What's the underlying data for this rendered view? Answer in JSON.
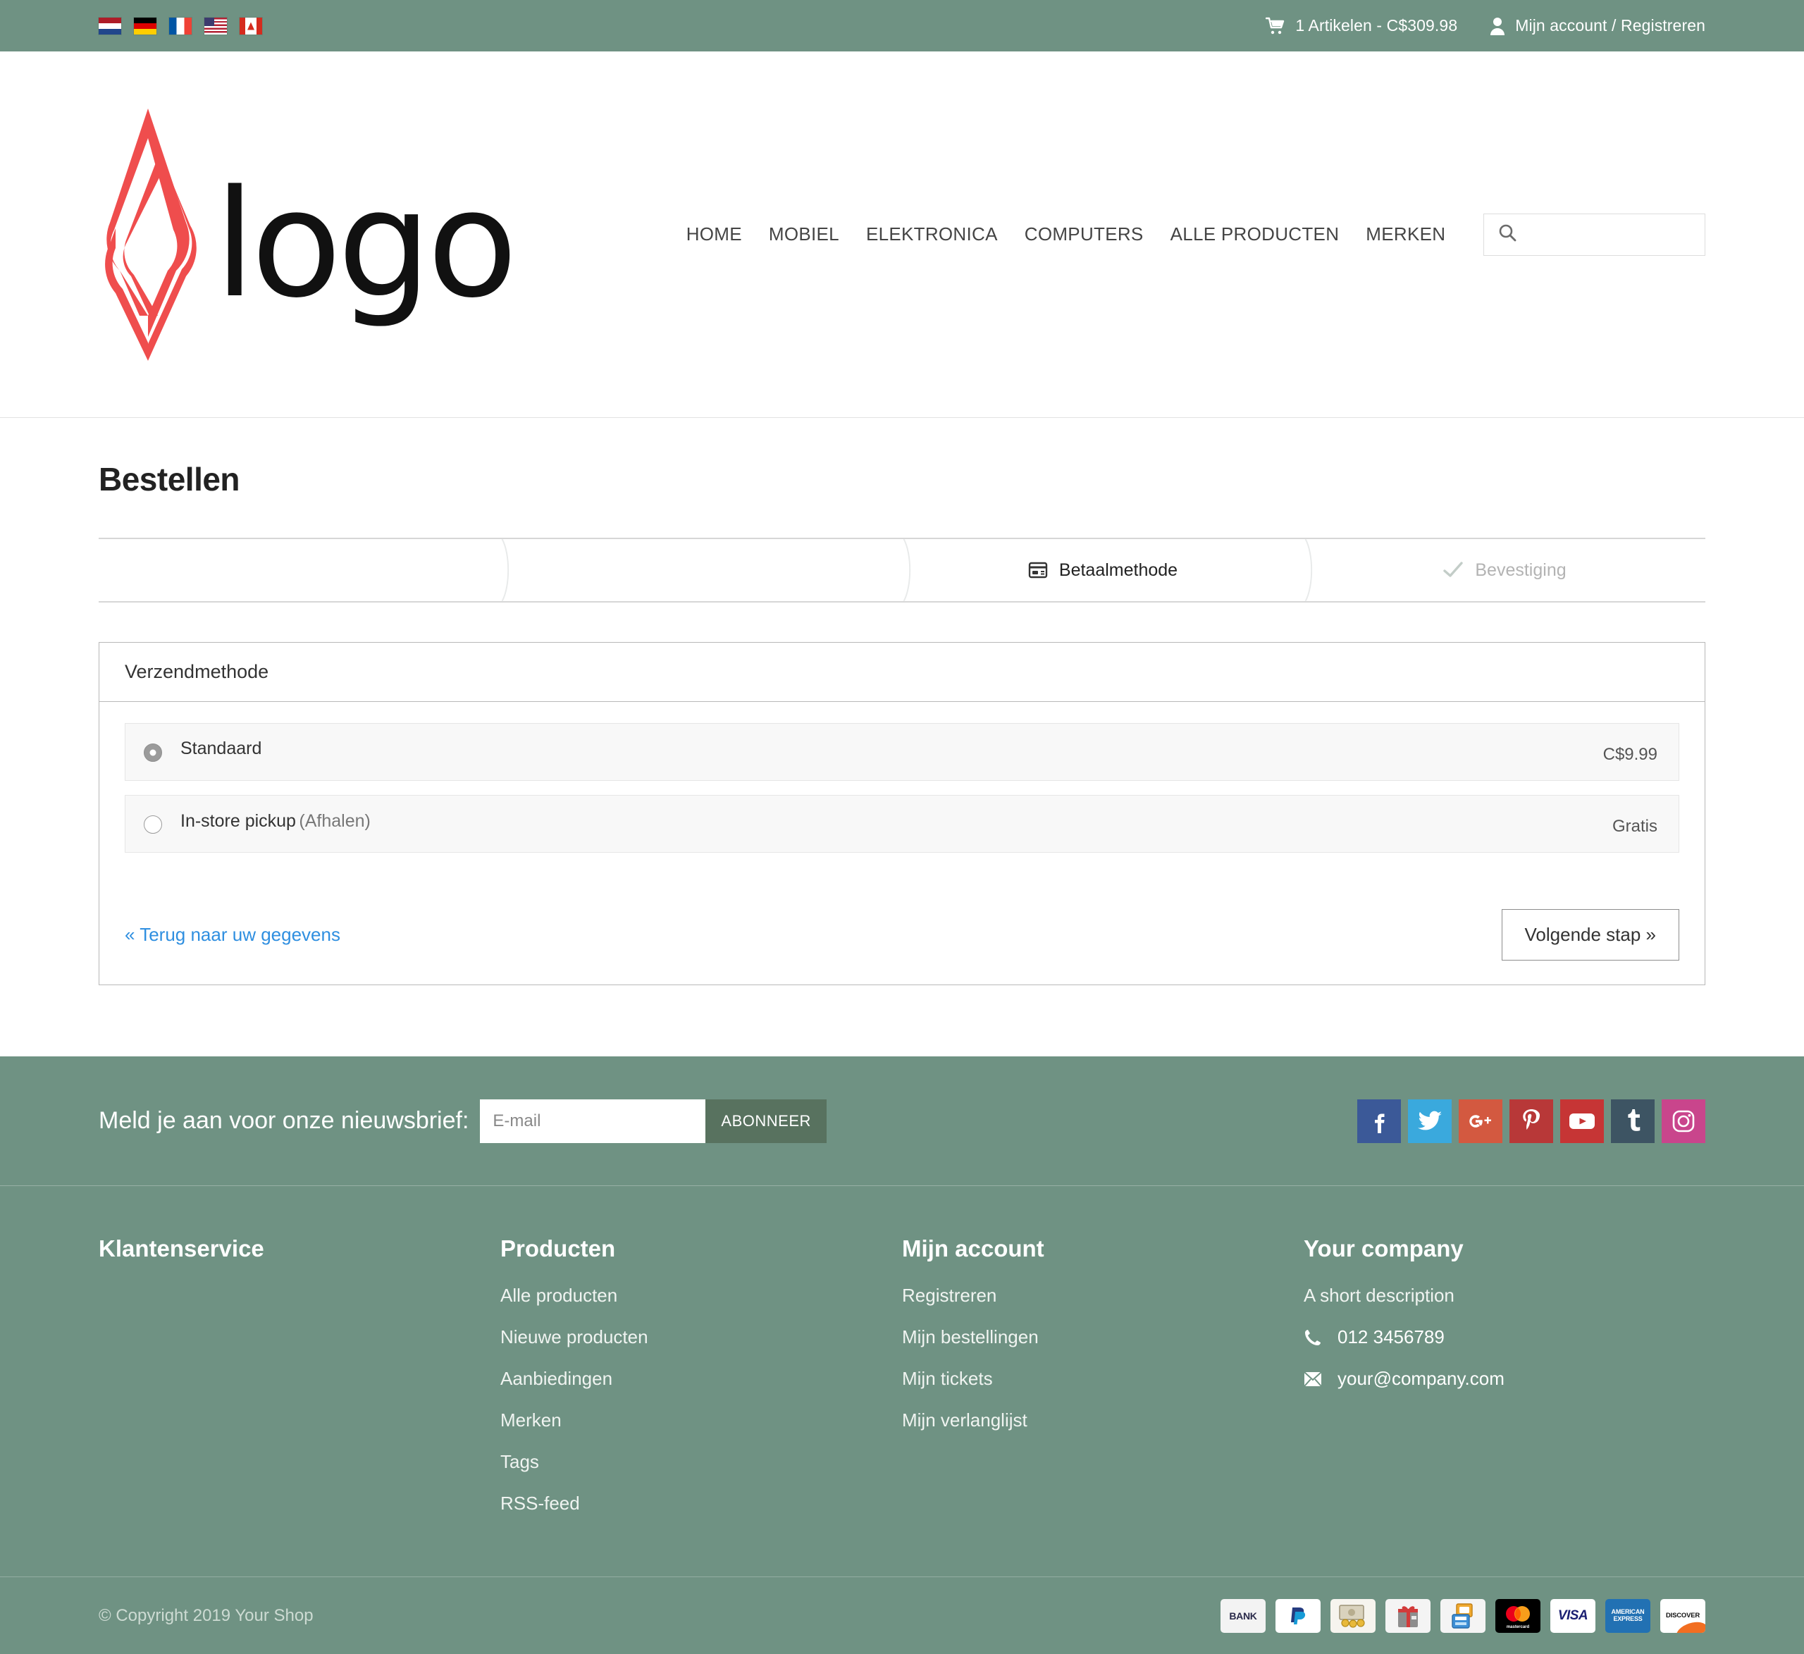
{
  "topbar": {
    "flags": [
      {
        "name": "flag-netherlands",
        "code": "nl",
        "title": "Nederlands"
      },
      {
        "name": "flag-germany",
        "code": "de",
        "title": "Deutsch"
      },
      {
        "name": "flag-france",
        "code": "fr",
        "title": "Français"
      },
      {
        "name": "flag-united-states",
        "code": "us",
        "title": "English"
      },
      {
        "name": "flag-canada",
        "code": "ca",
        "title": "Canada"
      }
    ],
    "cart": {
      "icon": "cart-icon",
      "label": "1 Artikelen - C$309.98"
    },
    "account": {
      "icon": "user-icon",
      "label": "Mijn account / Registreren"
    }
  },
  "header": {
    "logo_text": "logo",
    "logo_color": "#ef4d4d",
    "nav": [
      {
        "label": "HOME"
      },
      {
        "label": "MOBIEL"
      },
      {
        "label": "ELEKTRONICA"
      },
      {
        "label": "COMPUTERS"
      },
      {
        "label": "ALLE PRODUCTEN"
      },
      {
        "label": "MERKEN"
      }
    ],
    "search": {
      "icon": "search-icon",
      "placeholder": "",
      "value": ""
    }
  },
  "main": {
    "page_title": "Bestellen",
    "steps": [
      {
        "label": "",
        "icon": "",
        "state": "blank"
      },
      {
        "label": "",
        "icon": "",
        "state": "blank"
      },
      {
        "label": "Betaalmethode",
        "icon": "credit-card-icon",
        "state": "active"
      },
      {
        "label": "Bevestiging",
        "icon": "check-icon",
        "state": "muted"
      }
    ],
    "panel": {
      "title": "Verzendmethode",
      "options": [
        {
          "name": "Standaard",
          "sub": "",
          "price": "C$9.99",
          "selected": true
        },
        {
          "name": "In-store pickup",
          "sub": "(Afhalen)",
          "price": "Gratis",
          "selected": false
        }
      ],
      "back_link": "« Terug naar uw gegevens",
      "next_button": "Volgende stap »"
    }
  },
  "newsletter": {
    "label": "Meld je aan voor onze nieuwsbrief:",
    "placeholder": "E-mail",
    "value": "",
    "button": "ABONNEER",
    "socials": [
      {
        "name": "facebook-icon",
        "glyph": "f",
        "color": "#3b5998"
      },
      {
        "name": "twitter-icon",
        "glyph": "t",
        "color": "#3aa9dd"
      },
      {
        "name": "google-plus-icon",
        "glyph": "G+",
        "color": "#d35940"
      },
      {
        "name": "pinterest-icon",
        "glyph": "P",
        "color": "#b83838"
      },
      {
        "name": "youtube-icon",
        "glyph": "▶",
        "color": "#c63535"
      },
      {
        "name": "tumblr-icon",
        "glyph": "t",
        "color": "#3d5463"
      },
      {
        "name": "instagram-icon",
        "glyph": "◎",
        "color": "#c9458c"
      }
    ]
  },
  "footer": {
    "columns": [
      {
        "title": "Klantenservice",
        "links": []
      },
      {
        "title": "Producten",
        "links": [
          {
            "label": "Alle producten"
          },
          {
            "label": "Nieuwe producten"
          },
          {
            "label": "Aanbiedingen"
          },
          {
            "label": "Merken"
          },
          {
            "label": "Tags"
          },
          {
            "label": "RSS-feed"
          }
        ]
      },
      {
        "title": "Mijn account",
        "links": [
          {
            "label": "Registreren"
          },
          {
            "label": "Mijn bestellingen"
          },
          {
            "label": "Mijn tickets"
          },
          {
            "label": "Mijn verlanglijst"
          }
        ]
      },
      {
        "title": "Your company",
        "description": "A short description",
        "phone": "012 3456789",
        "email": "your@company.com",
        "phone_icon": "phone-icon",
        "email_icon": "envelope-icon"
      }
    ]
  },
  "copyright": {
    "text": "© Copyright 2019 Your Shop",
    "payment_methods": [
      {
        "name": "bank-transfer-icon",
        "label": "BANK"
      },
      {
        "name": "paypal-icon",
        "label": "PayPal"
      },
      {
        "name": "cash-icon",
        "label": "Cash"
      },
      {
        "name": "gift-card-icon",
        "label": "Gift"
      },
      {
        "name": "card-terminal-icon",
        "label": "Pin"
      },
      {
        "name": "mastercard-icon",
        "label": "mastercard"
      },
      {
        "name": "visa-icon",
        "label": "VISA"
      },
      {
        "name": "american-express-icon",
        "label": "AMERICAN EXPRESS"
      },
      {
        "name": "discover-icon",
        "label": "DISCOVER"
      }
    ]
  },
  "colors": {
    "brand_green": "#6f9283",
    "accent_red": "#ef4d4d",
    "link_blue": "#2f8fe0",
    "subscribe_green": "#58725f"
  }
}
